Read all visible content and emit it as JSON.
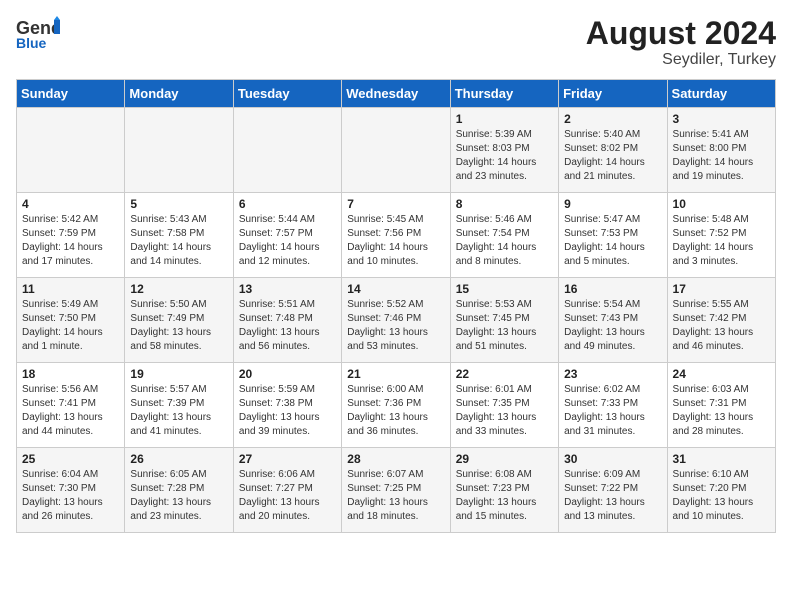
{
  "logo": {
    "general": "General",
    "blue": "Blue"
  },
  "title": "August 2024",
  "subtitle": "Seydiler, Turkey",
  "headers": [
    "Sunday",
    "Monday",
    "Tuesday",
    "Wednesday",
    "Thursday",
    "Friday",
    "Saturday"
  ],
  "weeks": [
    [
      {
        "day": "",
        "content": ""
      },
      {
        "day": "",
        "content": ""
      },
      {
        "day": "",
        "content": ""
      },
      {
        "day": "",
        "content": ""
      },
      {
        "day": "1",
        "content": "Sunrise: 5:39 AM\nSunset: 8:03 PM\nDaylight: 14 hours\nand 23 minutes."
      },
      {
        "day": "2",
        "content": "Sunrise: 5:40 AM\nSunset: 8:02 PM\nDaylight: 14 hours\nand 21 minutes."
      },
      {
        "day": "3",
        "content": "Sunrise: 5:41 AM\nSunset: 8:00 PM\nDaylight: 14 hours\nand 19 minutes."
      }
    ],
    [
      {
        "day": "4",
        "content": "Sunrise: 5:42 AM\nSunset: 7:59 PM\nDaylight: 14 hours\nand 17 minutes."
      },
      {
        "day": "5",
        "content": "Sunrise: 5:43 AM\nSunset: 7:58 PM\nDaylight: 14 hours\nand 14 minutes."
      },
      {
        "day": "6",
        "content": "Sunrise: 5:44 AM\nSunset: 7:57 PM\nDaylight: 14 hours\nand 12 minutes."
      },
      {
        "day": "7",
        "content": "Sunrise: 5:45 AM\nSunset: 7:56 PM\nDaylight: 14 hours\nand 10 minutes."
      },
      {
        "day": "8",
        "content": "Sunrise: 5:46 AM\nSunset: 7:54 PM\nDaylight: 14 hours\nand 8 minutes."
      },
      {
        "day": "9",
        "content": "Sunrise: 5:47 AM\nSunset: 7:53 PM\nDaylight: 14 hours\nand 5 minutes."
      },
      {
        "day": "10",
        "content": "Sunrise: 5:48 AM\nSunset: 7:52 PM\nDaylight: 14 hours\nand 3 minutes."
      }
    ],
    [
      {
        "day": "11",
        "content": "Sunrise: 5:49 AM\nSunset: 7:50 PM\nDaylight: 14 hours\nand 1 minute."
      },
      {
        "day": "12",
        "content": "Sunrise: 5:50 AM\nSunset: 7:49 PM\nDaylight: 13 hours\nand 58 minutes."
      },
      {
        "day": "13",
        "content": "Sunrise: 5:51 AM\nSunset: 7:48 PM\nDaylight: 13 hours\nand 56 minutes."
      },
      {
        "day": "14",
        "content": "Sunrise: 5:52 AM\nSunset: 7:46 PM\nDaylight: 13 hours\nand 53 minutes."
      },
      {
        "day": "15",
        "content": "Sunrise: 5:53 AM\nSunset: 7:45 PM\nDaylight: 13 hours\nand 51 minutes."
      },
      {
        "day": "16",
        "content": "Sunrise: 5:54 AM\nSunset: 7:43 PM\nDaylight: 13 hours\nand 49 minutes."
      },
      {
        "day": "17",
        "content": "Sunrise: 5:55 AM\nSunset: 7:42 PM\nDaylight: 13 hours\nand 46 minutes."
      }
    ],
    [
      {
        "day": "18",
        "content": "Sunrise: 5:56 AM\nSunset: 7:41 PM\nDaylight: 13 hours\nand 44 minutes."
      },
      {
        "day": "19",
        "content": "Sunrise: 5:57 AM\nSunset: 7:39 PM\nDaylight: 13 hours\nand 41 minutes."
      },
      {
        "day": "20",
        "content": "Sunrise: 5:59 AM\nSunset: 7:38 PM\nDaylight: 13 hours\nand 39 minutes."
      },
      {
        "day": "21",
        "content": "Sunrise: 6:00 AM\nSunset: 7:36 PM\nDaylight: 13 hours\nand 36 minutes."
      },
      {
        "day": "22",
        "content": "Sunrise: 6:01 AM\nSunset: 7:35 PM\nDaylight: 13 hours\nand 33 minutes."
      },
      {
        "day": "23",
        "content": "Sunrise: 6:02 AM\nSunset: 7:33 PM\nDaylight: 13 hours\nand 31 minutes."
      },
      {
        "day": "24",
        "content": "Sunrise: 6:03 AM\nSunset: 7:31 PM\nDaylight: 13 hours\nand 28 minutes."
      }
    ],
    [
      {
        "day": "25",
        "content": "Sunrise: 6:04 AM\nSunset: 7:30 PM\nDaylight: 13 hours\nand 26 minutes."
      },
      {
        "day": "26",
        "content": "Sunrise: 6:05 AM\nSunset: 7:28 PM\nDaylight: 13 hours\nand 23 minutes."
      },
      {
        "day": "27",
        "content": "Sunrise: 6:06 AM\nSunset: 7:27 PM\nDaylight: 13 hours\nand 20 minutes."
      },
      {
        "day": "28",
        "content": "Sunrise: 6:07 AM\nSunset: 7:25 PM\nDaylight: 13 hours\nand 18 minutes."
      },
      {
        "day": "29",
        "content": "Sunrise: 6:08 AM\nSunset: 7:23 PM\nDaylight: 13 hours\nand 15 minutes."
      },
      {
        "day": "30",
        "content": "Sunrise: 6:09 AM\nSunset: 7:22 PM\nDaylight: 13 hours\nand 13 minutes."
      },
      {
        "day": "31",
        "content": "Sunrise: 6:10 AM\nSunset: 7:20 PM\nDaylight: 13 hours\nand 10 minutes."
      }
    ]
  ]
}
